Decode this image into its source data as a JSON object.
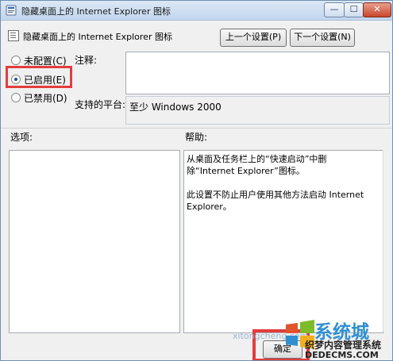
{
  "window": {
    "title": "隐藏桌面上的 Internet Explorer 图标",
    "minimize_glyph": "—",
    "maximize_glyph": "☐",
    "close_glyph": "✕"
  },
  "header": {
    "policy_name": "隐藏桌面上的 Internet Explorer 图标",
    "prev_label": "上一个设置(P)",
    "next_label": "下一个设置(N)"
  },
  "state": {
    "options": [
      {
        "label": "未配置(C)",
        "selected": false
      },
      {
        "label": "已启用(E)",
        "selected": true
      },
      {
        "label": "已禁用(D)",
        "selected": false
      }
    ]
  },
  "comment": {
    "label": "注释:",
    "value": ""
  },
  "platform": {
    "label": "支持的平台:",
    "value": "至少 Windows 2000"
  },
  "options_panel": {
    "label": "选项:"
  },
  "help_panel": {
    "label": "帮助:",
    "paragraphs": [
      "从桌面及任务栏上的“快速启动”中删除“Internet Explorer”图标。",
      "此设置不防止用户使用其他方法启动 Internet Explorer。"
    ]
  },
  "footer": {
    "ok_label": "确定"
  },
  "watermark": {
    "brand_big": "系统城",
    "line1": "织梦内容管理系统",
    "line2": "DEDECMS.COM",
    "faint": "xitongcheng.com"
  },
  "colors": {
    "highlight_red": "#e23d3d",
    "radio_blue": "#1b4f9c",
    "watermark_blue": "#2f8fd1"
  }
}
